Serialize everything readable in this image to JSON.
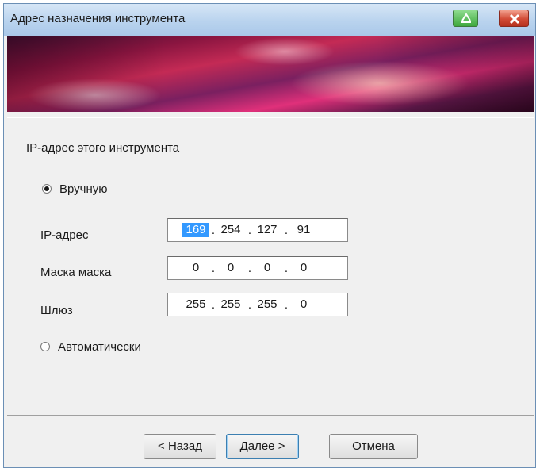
{
  "window": {
    "title": "Адрес назначения инструмента"
  },
  "section": {
    "heading": "IP-адрес этого инструмента"
  },
  "mode": {
    "manual_label": "Вручную",
    "manual_selected": true,
    "auto_label": "Автоматически",
    "auto_selected": false
  },
  "fields": [
    {
      "label": "IP-адрес",
      "octets": [
        "169",
        "254",
        "127",
        "91"
      ]
    },
    {
      "label": "Маска маска",
      "octets": [
        "0",
        "0",
        "0",
        "0"
      ]
    },
    {
      "label": "Шлюз",
      "octets": [
        "255",
        "255",
        "255",
        "0"
      ]
    }
  ],
  "separator": ".",
  "buttons": {
    "back": "< Назад",
    "next": "Далее >",
    "cancel": "Отмена"
  },
  "colors": {
    "selection": "#3399ff",
    "close_button": "#d24b36",
    "help_button": "#3ea83e"
  }
}
